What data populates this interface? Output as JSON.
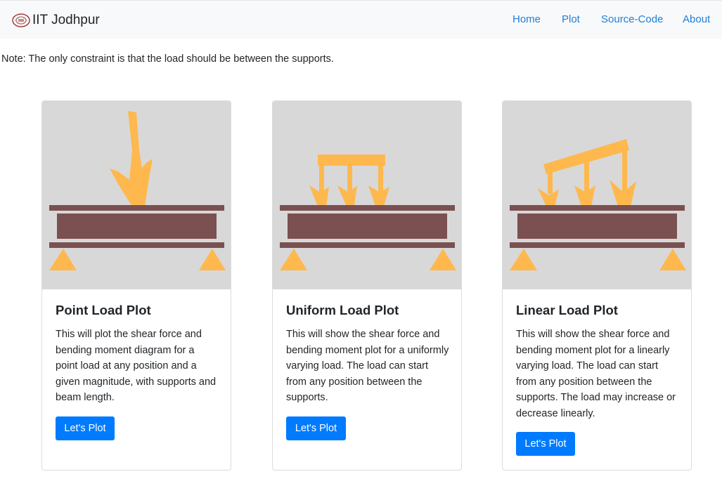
{
  "navbar": {
    "brand": "IIT Jodhpur",
    "links": [
      "Home",
      "Plot",
      "Source-Code",
      "About"
    ]
  },
  "note": "Note: The only constraint is that the load should be between the supports.",
  "cards": [
    {
      "title": "Point Load Plot",
      "text": "This will plot the shear force and bending moment diagram for a point load at any position and a given magnitude, with supports and beam length.",
      "button": "Let's Plot"
    },
    {
      "title": "Uniform Load Plot",
      "text": "This will show the shear force and bending moment plot for a uniformly varying load. The load can start from any position between the supports.",
      "button": "Let's Plot"
    },
    {
      "title": "Linear Load Plot",
      "text": "This will show the shear force and bending moment plot for a linearly varying load. The load can start from any position between the supports. The load may increase or decrease linearly.",
      "button": "Let's Plot"
    }
  ],
  "colors": {
    "navbar_bg": "#f8f9fa",
    "link": "#1f7fd6",
    "button": "#007bff",
    "illustration_bg": "#d8d8d8",
    "beam": "#7a5050",
    "load": "#ffb84d"
  },
  "icons": [
    "iit-jodhpur-logo-icon",
    "point-load-beam-illustration",
    "uniform-load-beam-illustration",
    "linear-load-beam-illustration"
  ]
}
